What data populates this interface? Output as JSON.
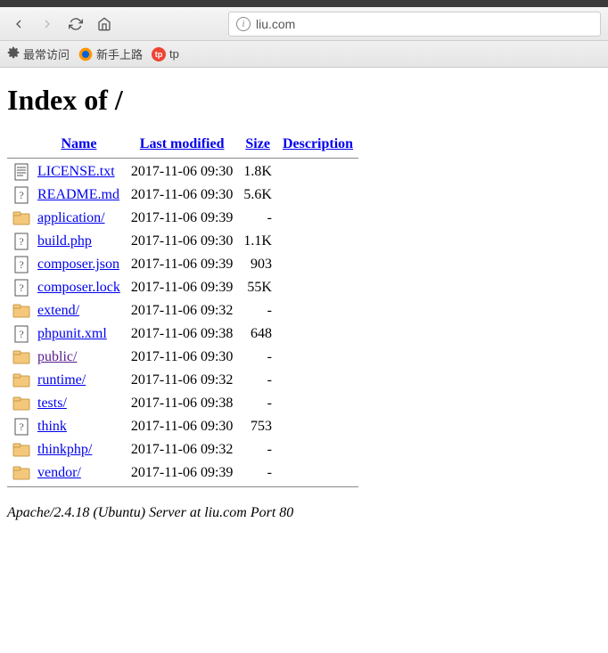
{
  "browser": {
    "url": "liu.com",
    "bookmarks": {
      "frequent": "最常访问",
      "getting_started": "新手上路",
      "tp": "tp"
    }
  },
  "page": {
    "title": "Index of /",
    "headers": {
      "name": "Name",
      "modified": "Last modified",
      "size": "Size",
      "description": "Description"
    },
    "files": [
      {
        "icon": "text",
        "name": "LICENSE.txt",
        "modified": "2017-11-06 09:30",
        "size": "1.8K",
        "visited": false
      },
      {
        "icon": "unknown",
        "name": "README.md",
        "modified": "2017-11-06 09:30",
        "size": "5.6K",
        "visited": false
      },
      {
        "icon": "folder",
        "name": "application/",
        "modified": "2017-11-06 09:39",
        "size": "-",
        "visited": false
      },
      {
        "icon": "unknown",
        "name": "build.php",
        "modified": "2017-11-06 09:30",
        "size": "1.1K",
        "visited": false
      },
      {
        "icon": "unknown",
        "name": "composer.json",
        "modified": "2017-11-06 09:39",
        "size": "903",
        "visited": false
      },
      {
        "icon": "unknown",
        "name": "composer.lock",
        "modified": "2017-11-06 09:39",
        "size": "55K",
        "visited": false
      },
      {
        "icon": "folder",
        "name": "extend/",
        "modified": "2017-11-06 09:32",
        "size": "-",
        "visited": false
      },
      {
        "icon": "unknown",
        "name": "phpunit.xml",
        "modified": "2017-11-06 09:38",
        "size": "648",
        "visited": false
      },
      {
        "icon": "folder",
        "name": "public/",
        "modified": "2017-11-06 09:30",
        "size": "-",
        "visited": true
      },
      {
        "icon": "folder",
        "name": "runtime/",
        "modified": "2017-11-06 09:32",
        "size": "-",
        "visited": false
      },
      {
        "icon": "folder",
        "name": "tests/",
        "modified": "2017-11-06 09:38",
        "size": "-",
        "visited": false
      },
      {
        "icon": "unknown",
        "name": "think",
        "modified": "2017-11-06 09:30",
        "size": "753",
        "visited": false
      },
      {
        "icon": "folder",
        "name": "thinkphp/",
        "modified": "2017-11-06 09:32",
        "size": "-",
        "visited": false
      },
      {
        "icon": "folder",
        "name": "vendor/",
        "modified": "2017-11-06 09:39",
        "size": "-",
        "visited": false
      }
    ],
    "footer": "Apache/2.4.18 (Ubuntu) Server at liu.com Port 80"
  }
}
